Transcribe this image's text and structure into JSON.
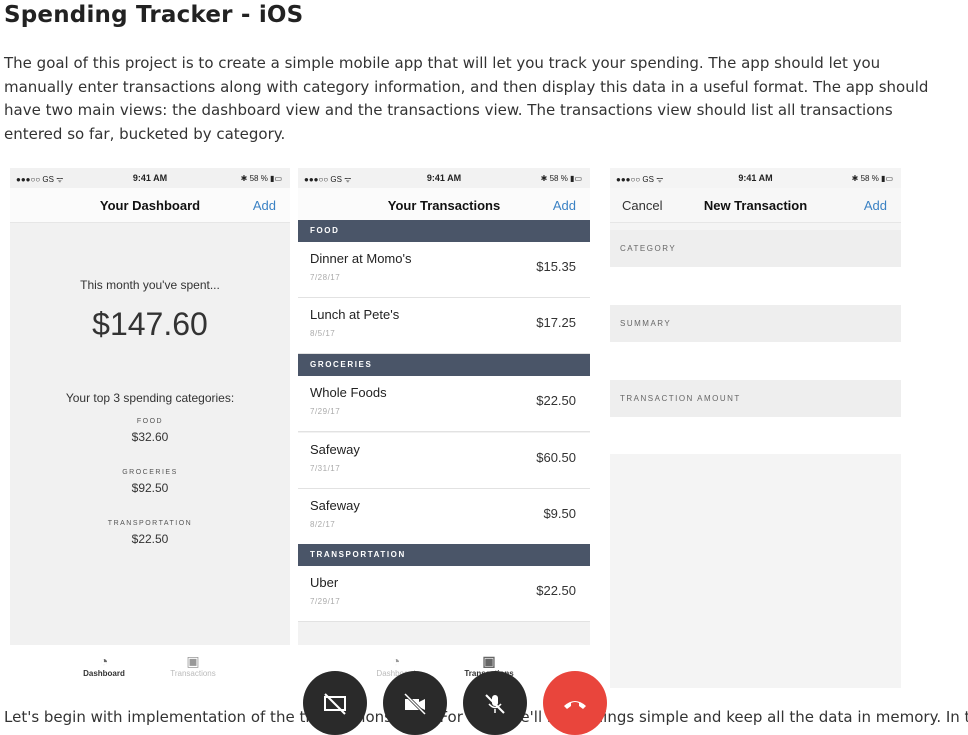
{
  "page": {
    "title": "Spending Tracker - iOS",
    "intro": "The goal of this project is to create a simple mobile app that will let you track your spending. The app should let you manually enter transactions along with category information, and then display this data in a useful format.  The app should have two main views: the dashboard view and the transactions view. The transactions view should list all transactions entered so far, bucketed by category.",
    "bottom_text": "Let's begin with implementation of the transactions view. For now, we'll keep things simple and keep all the data in memory. In the"
  },
  "status": {
    "carrier": "●●●○○ GS ᯤ",
    "time": "9:41 AM",
    "battery": "✱ 58 % ▮▭"
  },
  "dashboard": {
    "title": "Your Dashboard",
    "add": "Add",
    "month_label": "This month you've spent...",
    "total": "$147.60",
    "top_label": "Your top 3 spending categories:",
    "categories": [
      {
        "name": "FOOD",
        "amount": "$32.60"
      },
      {
        "name": "GROCERIES",
        "amount": "$92.50"
      },
      {
        "name": "TRANSPORTATION",
        "amount": "$22.50"
      }
    ],
    "tabs": [
      {
        "label": "Dashboard",
        "icon": "gauge-icon"
      },
      {
        "label": "Transactions",
        "icon": "money-icon"
      }
    ]
  },
  "transactions": {
    "title": "Your Transactions",
    "add": "Add",
    "sections": [
      {
        "name": "FOOD",
        "rows": [
          {
            "name": "Dinner at Momo's",
            "date": "7/28/17",
            "amount": "$15.35"
          },
          {
            "name": "Lunch at Pete's",
            "date": "8/5/17",
            "amount": "$17.25"
          }
        ]
      },
      {
        "name": "GROCERIES",
        "rows": [
          {
            "name": "Whole Foods",
            "date": "7/29/17",
            "amount": "$22.50"
          },
          {
            "name": "Safeway",
            "date": "7/31/17",
            "amount": "$60.50"
          },
          {
            "name": "Safeway",
            "date": "8/2/17",
            "amount": "$9.50"
          }
        ]
      },
      {
        "name": "TRANSPORTATION",
        "rows": [
          {
            "name": "Uber",
            "date": "7/29/17",
            "amount": "$22.50"
          }
        ]
      }
    ],
    "tabs": [
      {
        "label": "Dashboard",
        "icon": "gauge-icon"
      },
      {
        "label": "Transactions",
        "icon": "money-icon"
      }
    ]
  },
  "new_transaction": {
    "cancel": "Cancel",
    "title": "New Transaction",
    "add": "Add",
    "fields": [
      "CATEGORY",
      "SUMMARY",
      "TRANSACTION AMOUNT"
    ]
  },
  "call_controls": [
    {
      "name": "screen-share-off-icon",
      "glyph": "⧄"
    },
    {
      "name": "camera-off-icon",
      "glyph": "⛌"
    },
    {
      "name": "mic-off-icon",
      "glyph": "🎙"
    },
    {
      "name": "end-call-icon",
      "glyph": "☎"
    }
  ],
  "colors": {
    "accent": "#3b82c4",
    "section": "#4a5568",
    "end_call": "#e9453c"
  }
}
